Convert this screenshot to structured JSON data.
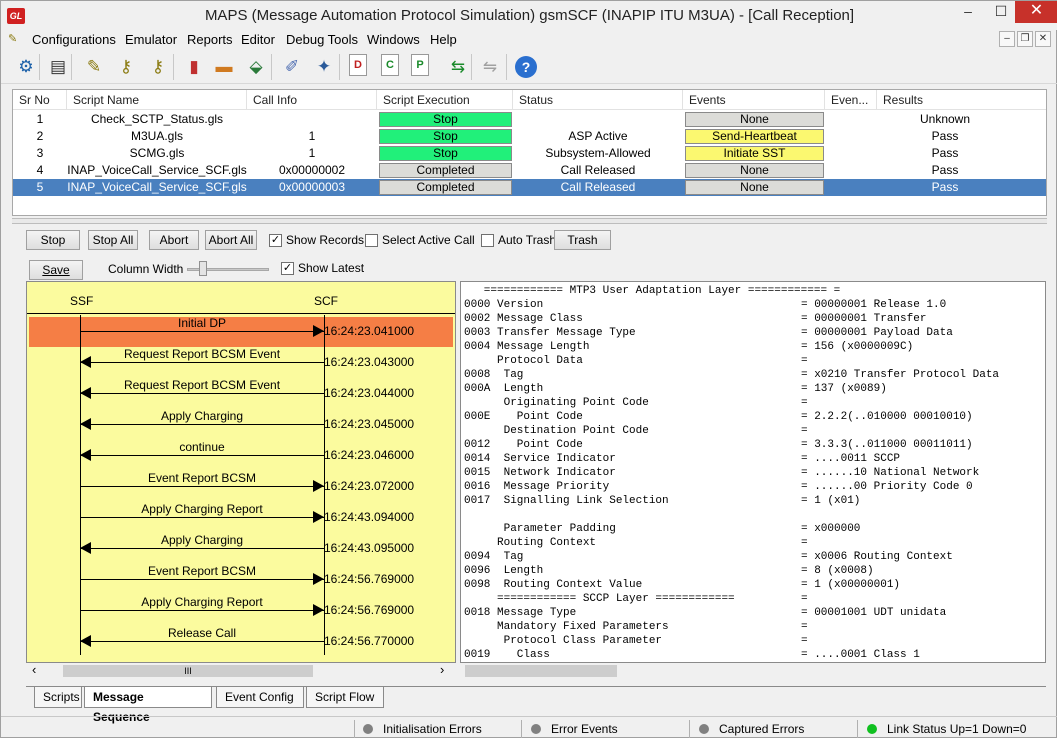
{
  "window": {
    "title": "MAPS (Message Automation Protocol Simulation) gsmSCF (INAPIP ITU M3UA) - [Call Reception]",
    "logo_text": "GL",
    "min_glyph": "–",
    "max_glyph": "☐",
    "close_glyph": "✕"
  },
  "menu": {
    "items": [
      "Configurations",
      "Emulator",
      "Reports",
      "Editor",
      "Debug Tools",
      "Windows",
      "Help"
    ],
    "mdi_min": "–",
    "mdi_restore": "❐",
    "mdi_close": "✕"
  },
  "toolbar": {
    "icons": [
      {
        "name": "gear-icon",
        "glyph": "⚙",
        "color": "#1a5fa8"
      },
      {
        "name": "notebook-icon",
        "glyph": "▤",
        "color": "#333333"
      },
      {
        "name": "edit-script-icon",
        "glyph": "✎",
        "color": "#8a7a10"
      },
      {
        "name": "keys-icon",
        "glyph": "⚷",
        "color": "#8a7a10"
      },
      {
        "name": "keys-multi-icon",
        "glyph": "⚷",
        "color": "#8a7a10"
      },
      {
        "name": "database-icon",
        "glyph": "▮",
        "color": "#c03030"
      },
      {
        "name": "briefcase-icon",
        "glyph": "▬",
        "color": "#d07a20"
      },
      {
        "name": "network-icon",
        "glyph": "⬙",
        "color": "#2a7a3a"
      },
      {
        "name": "edit-pencil-icon",
        "glyph": "✐",
        "color": "#4a6ab0"
      },
      {
        "name": "wizard-icon",
        "glyph": "✦",
        "color": "#2a5a9a"
      },
      {
        "name": "doc-d-icon",
        "glyph": "D",
        "color": "#c02020"
      },
      {
        "name": "doc-c-icon",
        "glyph": "C",
        "color": "#1a8a2a"
      },
      {
        "name": "doc-p-icon",
        "glyph": "P",
        "color": "#1a8a2a"
      },
      {
        "name": "transfer-icon",
        "glyph": "⇆",
        "color": "#1a8a2a"
      },
      {
        "name": "disabled-icon",
        "glyph": "⇋",
        "color": "#a0a0a0"
      },
      {
        "name": "help-icon",
        "glyph": "?",
        "color": "#ffffff"
      }
    ]
  },
  "scripts_table": {
    "headers": [
      "Sr No",
      "Script Name",
      "Call Info",
      "Script Execution",
      "Status",
      "Events",
      "Even...",
      "Results"
    ],
    "rows": [
      {
        "sr": "1",
        "script": "Check_SCTP_Status.gls",
        "call_info": "",
        "exec": "Stop",
        "exec_style": "green",
        "status": "",
        "event": "None",
        "event_style": "gray",
        "result": "Unknown"
      },
      {
        "sr": "2",
        "script": "M3UA.gls",
        "call_info": "1",
        "exec": "Stop",
        "exec_style": "green",
        "status": "ASP Active",
        "event": "Send-Heartbeat",
        "event_style": "yellow",
        "result": "Pass"
      },
      {
        "sr": "3",
        "script": "SCMG.gls",
        "call_info": "1",
        "exec": "Stop",
        "exec_style": "green",
        "status": "Subsystem-Allowed",
        "event": "Initiate SST",
        "event_style": "yellow",
        "result": "Pass"
      },
      {
        "sr": "4",
        "script": "INAP_VoiceCall_Service_SCF.gls",
        "call_info": "0x00000002",
        "exec": "Completed",
        "exec_style": "gray",
        "status": "Call Released",
        "event": "None",
        "event_style": "gray",
        "result": "Pass"
      },
      {
        "sr": "5",
        "script": "INAP_VoiceCall_Service_SCF.gls",
        "call_info": "0x00000003",
        "exec": "Completed",
        "exec_style": "gray",
        "status": "Call Released",
        "event": "None",
        "event_style": "gray",
        "result": "Pass"
      }
    ]
  },
  "controls": {
    "stop": "Stop",
    "stop_all": "Stop All",
    "abort": "Abort",
    "abort_all": "Abort All",
    "show_records": "Show Records",
    "show_records_checked": true,
    "select_active_call": "Select Active Call",
    "select_active_call_checked": false,
    "auto_trash": "Auto Trash",
    "auto_trash_checked": false,
    "trash": "Trash",
    "save": "Save",
    "column_width": "Column Width",
    "show_latest": "Show Latest",
    "show_latest_checked": true,
    "checkmark": "✓"
  },
  "sequence": {
    "left_entity": "SSF",
    "right_entity": "SCF",
    "highlight_color": "#f57e45",
    "messages": [
      {
        "label": "Initial DP",
        "dir": "right",
        "time": "16:24:23.041000"
      },
      {
        "label": "Request Report BCSM Event",
        "dir": "left",
        "time": "16:24:23.043000"
      },
      {
        "label": "Request Report BCSM Event",
        "dir": "left",
        "time": "16:24:23.044000"
      },
      {
        "label": "Apply Charging",
        "dir": "left",
        "time": "16:24:23.045000"
      },
      {
        "label": "continue",
        "dir": "left",
        "time": "16:24:23.046000"
      },
      {
        "label": "Event Report BCSM",
        "dir": "right",
        "time": "16:24:23.072000"
      },
      {
        "label": "Apply Charging Report",
        "dir": "right",
        "time": "16:24:43.094000"
      },
      {
        "label": "Apply Charging",
        "dir": "left",
        "time": "16:24:43.095000"
      },
      {
        "label": "Event Report BCSM",
        "dir": "right",
        "time": "16:24:56.769000"
      },
      {
        "label": "Apply Charging Report",
        "dir": "right",
        "time": "16:24:56.769000"
      },
      {
        "label": "Release Call",
        "dir": "left",
        "time": "16:24:56.770000"
      }
    ],
    "scroll_left": "‹",
    "scroll_right": "›",
    "scroll_grip": "III"
  },
  "decode": {
    "lines": [
      {
        "left": "   ============ MTP3 User Adaptation Layer ============ =",
        "right": ""
      },
      {
        "left": "0000 Version",
        "right": "= 00000001 Release 1.0"
      },
      {
        "left": "0002 Message Class",
        "right": "= 00000001 Transfer"
      },
      {
        "left": "0003 Transfer Message Type",
        "right": "= 00000001 Payload Data"
      },
      {
        "left": "0004 Message Length",
        "right": "= 156 (x0000009C)"
      },
      {
        "left": "     Protocol Data",
        "right": "="
      },
      {
        "left": "0008  Tag",
        "right": "= x0210 Transfer Protocol Data"
      },
      {
        "left": "000A  Length",
        "right": "= 137 (x0089)"
      },
      {
        "left": "      Originating Point Code",
        "right": "="
      },
      {
        "left": "000E    Point Code",
        "right": "= 2.2.2(..010000 00010010)"
      },
      {
        "left": "      Destination Point Code",
        "right": "="
      },
      {
        "left": "0012    Point Code",
        "right": "= 3.3.3(..011000 00011011)"
      },
      {
        "left": "0014  Service Indicator",
        "right": "= ....0011 SCCP"
      },
      {
        "left": "0015  Network Indicator",
        "right": "= ......10 National Network"
      },
      {
        "left": "0016  Message Priority",
        "right": "= ......00 Priority Code 0"
      },
      {
        "left": "0017  Signalling Link Selection",
        "right": "= 1 (x01)"
      },
      {
        "left": "",
        "right": ""
      },
      {
        "left": "      Parameter Padding",
        "right": "= x000000"
      },
      {
        "left": "     Routing Context",
        "right": "="
      },
      {
        "left": "0094  Tag",
        "right": "= x0006 Routing Context"
      },
      {
        "left": "0096  Length",
        "right": "= 8 (x0008)"
      },
      {
        "left": "0098  Routing Context Value",
        "right": "= 1 (x00000001)"
      },
      {
        "left": "     ============ SCCP Layer ============",
        "right": "="
      },
      {
        "left": "0018 Message Type",
        "right": "= 00001001 UDT unidata"
      },
      {
        "left": "     Mandatory Fixed Parameters",
        "right": "="
      },
      {
        "left": "      Protocol Class Parameter",
        "right": "="
      },
      {
        "left": "0019    Class",
        "right": "= ....0001 Class 1"
      }
    ]
  },
  "tabs": [
    "Scripts",
    "Message Sequence",
    "Event Config",
    "Script Flow"
  ],
  "status_bar": {
    "items": [
      {
        "label": "Initialisation Errors",
        "color": "#808080"
      },
      {
        "label": "Error Events",
        "color": "#808080"
      },
      {
        "label": "Captured Errors",
        "color": "#808080"
      },
      {
        "label": "Link Status Up=1 Down=0",
        "color": "#10c020"
      }
    ]
  }
}
